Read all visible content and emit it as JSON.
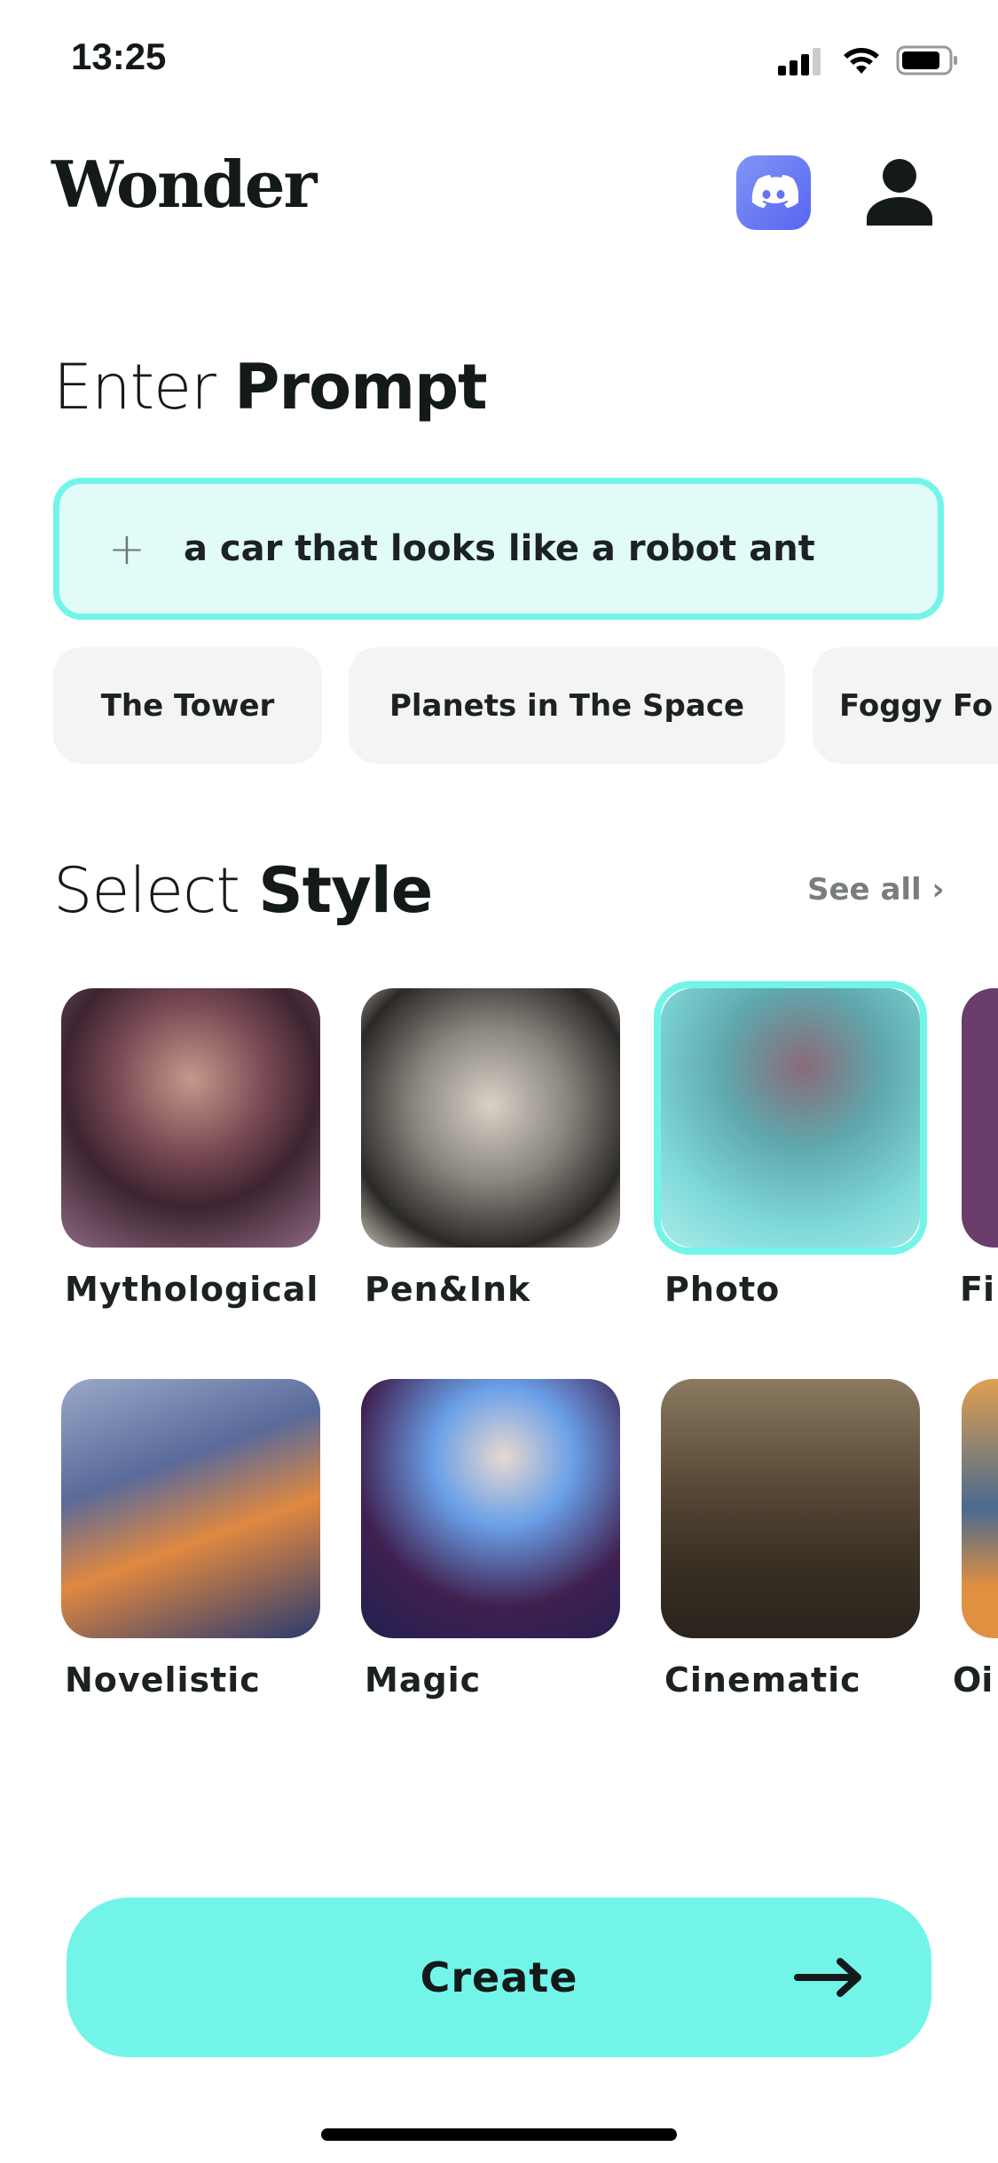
{
  "status_bar": {
    "time": "13:25"
  },
  "header": {
    "logo": "Wonder",
    "discord_icon": "discord-icon",
    "profile_icon": "user-icon"
  },
  "prompt": {
    "title_light": "Enter",
    "title_bold": "Prompt",
    "value": "a car that looks like a robot ant",
    "add_icon": "plus-icon"
  },
  "suggestions": [
    "The Tower",
    "Planets in The Space",
    "Foggy Fo"
  ],
  "styles": {
    "title_light": "Select",
    "title_bold": "Style",
    "see_all": "See all",
    "selected": "Photo",
    "items": [
      {
        "label": "Mythological"
      },
      {
        "label": "Pen&Ink"
      },
      {
        "label": "Photo"
      },
      {
        "label": "Fi"
      },
      {
        "label": "Novelistic"
      },
      {
        "label": "Magic"
      },
      {
        "label": "Cinematic"
      },
      {
        "label": "Oi"
      }
    ]
  },
  "create_button": {
    "label": "Create",
    "icon": "arrow-right-icon"
  },
  "colors": {
    "accent": "#72f5e8",
    "input_bg": "#e0fbf8",
    "chip_bg": "#f4f4f4",
    "discord": "#5865f2"
  }
}
